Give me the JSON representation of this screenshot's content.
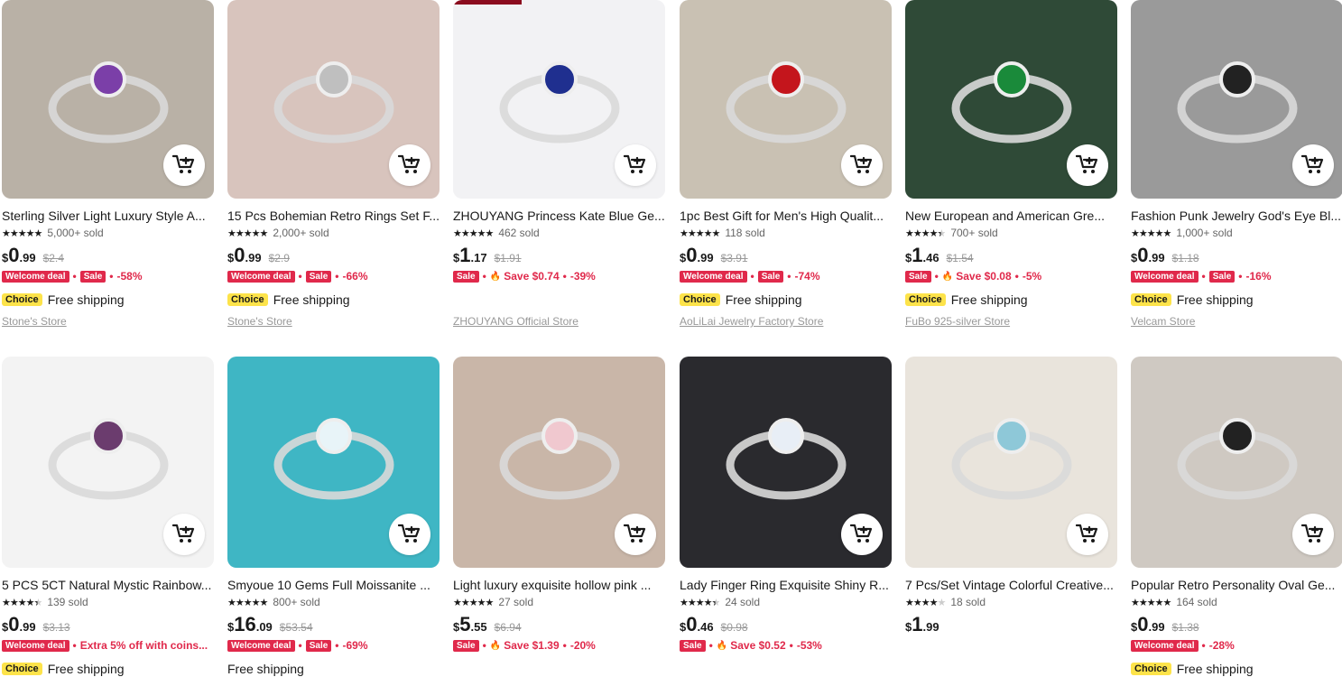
{
  "products": [
    {
      "title": "Sterling Silver Light Luxury Style A...",
      "rating": 5,
      "sold": "5,000+ sold",
      "currency": "$",
      "price_int": "0",
      "price_dec": ".99",
      "original": "$2.4",
      "deals": [
        {
          "type": "badge",
          "text": "Welcome deal"
        },
        {
          "type": "badge",
          "text": "Sale"
        },
        {
          "type": "text",
          "text": "-58%"
        }
      ],
      "choice": "Choice",
      "shipping": "Free shipping",
      "store": "Stone's Store",
      "bg": "#b9b1a6"
    },
    {
      "title": "15 Pcs Bohemian Retro Rings Set F...",
      "rating": 5,
      "sold": "2,000+ sold",
      "currency": "$",
      "price_int": "0",
      "price_dec": ".99",
      "original": "$2.9",
      "deals": [
        {
          "type": "badge",
          "text": "Welcome deal"
        },
        {
          "type": "badge",
          "text": "Sale"
        },
        {
          "type": "text",
          "text": "-66%"
        }
      ],
      "choice": "Choice",
      "shipping": "Free shipping",
      "store": "Stone's Store",
      "bg": "#d8c4bd"
    },
    {
      "title": "ZHOUYANG Princess Kate Blue Ge...",
      "rating": 5,
      "sold": "462 sold",
      "currency": "$",
      "price_int": "1",
      "price_dec": ".17",
      "original": "$1.91",
      "deals": [
        {
          "type": "badge",
          "text": "Sale"
        },
        {
          "type": "flame",
          "text": "Save $0.74"
        },
        {
          "type": "text",
          "text": "-39%"
        }
      ],
      "choice": "",
      "shipping": "",
      "store": "ZHOUYANG Official Store",
      "bg": "#f2f2f4"
    },
    {
      "title": "1pc Best Gift for Men's High Qualit...",
      "rating": 5,
      "sold": "118 sold",
      "currency": "$",
      "price_int": "0",
      "price_dec": ".99",
      "original": "$3.91",
      "deals": [
        {
          "type": "badge",
          "text": "Welcome deal"
        },
        {
          "type": "badge",
          "text": "Sale"
        },
        {
          "type": "text",
          "text": "-74%"
        }
      ],
      "choice": "Choice",
      "shipping": "Free shipping",
      "store": "AoLiLai Jewelry Factory Store",
      "bg": "#c9c1b3"
    },
    {
      "title": "New European and American Gre...",
      "rating": 4.5,
      "sold": "700+ sold",
      "currency": "$",
      "price_int": "1",
      "price_dec": ".46",
      "original": "$1.54",
      "deals": [
        {
          "type": "badge",
          "text": "Sale"
        },
        {
          "type": "flame",
          "text": "Save $0.08"
        },
        {
          "type": "text",
          "text": "-5%"
        }
      ],
      "choice": "Choice",
      "shipping": "Free shipping",
      "store": "FuBo 925-silver Store",
      "bg": "#2f4a37"
    },
    {
      "title": "Fashion Punk Jewelry God's Eye Bl...",
      "rating": 5,
      "sold": "1,000+ sold",
      "currency": "$",
      "price_int": "0",
      "price_dec": ".99",
      "original": "$1.18",
      "deals": [
        {
          "type": "badge",
          "text": "Welcome deal"
        },
        {
          "type": "badge",
          "text": "Sale"
        },
        {
          "type": "text",
          "text": "-16%"
        }
      ],
      "choice": "Choice",
      "shipping": "Free shipping",
      "store": "Velcam Store",
      "bg": "#9a9a9a"
    },
    {
      "title": "5 PCS 5CT Natural Mystic Rainbow...",
      "rating": 4.5,
      "sold": "139 sold",
      "currency": "$",
      "price_int": "0",
      "price_dec": ".99",
      "original": "$3.13",
      "deals": [
        {
          "type": "badge",
          "text": "Welcome deal"
        },
        {
          "type": "extra",
          "text": "Extra 5% off with coins..."
        }
      ],
      "choice": "Choice",
      "shipping": "Free shipping",
      "store": "",
      "bg": "#f3f3f3"
    },
    {
      "title": "Smyoue 10 Gems Full Moissanite ...",
      "rating": 5,
      "sold": "800+ sold",
      "currency": "$",
      "price_int": "16",
      "price_dec": ".09",
      "original": "$53.54",
      "deals": [
        {
          "type": "badge",
          "text": "Welcome deal"
        },
        {
          "type": "badge",
          "text": "Sale"
        },
        {
          "type": "text",
          "text": "-69%"
        }
      ],
      "choice": "",
      "shipping": "Free shipping",
      "store": "",
      "bg": "#3fb6c4"
    },
    {
      "title": "Light luxury exquisite hollow pink ...",
      "rating": 5,
      "sold": "27 sold",
      "currency": "$",
      "price_int": "5",
      "price_dec": ".55",
      "original": "$6.94",
      "deals": [
        {
          "type": "badge",
          "text": "Sale"
        },
        {
          "type": "flame",
          "text": "Save $1.39"
        },
        {
          "type": "text",
          "text": "-20%"
        }
      ],
      "choice": "",
      "shipping": "",
      "store": "",
      "bg": "#c9b6a8"
    },
    {
      "title": "Lady Finger Ring Exquisite Shiny R...",
      "rating": 4.5,
      "sold": "24 sold",
      "currency": "$",
      "price_int": "0",
      "price_dec": ".46",
      "original": "$0.98",
      "deals": [
        {
          "type": "badge",
          "text": "Sale"
        },
        {
          "type": "flame",
          "text": "Save $0.52"
        },
        {
          "type": "text",
          "text": "-53%"
        }
      ],
      "choice": "",
      "shipping": "",
      "store": "",
      "bg": "#2a2a2e"
    },
    {
      "title": "7 Pcs/Set Vintage Colorful Creative...",
      "rating": 4,
      "sold": "18 sold",
      "currency": "$",
      "price_int": "1",
      "price_dec": ".99",
      "original": "",
      "deals": [],
      "choice": "",
      "shipping": "",
      "store": "",
      "bg": "#e9e4dc"
    },
    {
      "title": "Popular Retro Personality Oval Ge...",
      "rating": 5,
      "sold": "164 sold",
      "currency": "$",
      "price_int": "0",
      "price_dec": ".99",
      "original": "$1.38",
      "deals": [
        {
          "type": "badge",
          "text": "Welcome deal"
        },
        {
          "type": "text",
          "text": "-28%"
        }
      ],
      "choice": "Choice",
      "shipping": "Free shipping",
      "store": "",
      "bg": "#cfc9c2"
    }
  ],
  "icons": {
    "cart": "add-to-cart-icon"
  }
}
